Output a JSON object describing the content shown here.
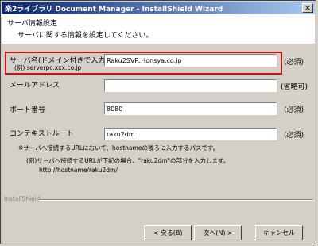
{
  "window": {
    "title": "楽2ライブラリ Document Manager - InstallShield Wizard",
    "close_label": "✕"
  },
  "header": {
    "title": "サーバ情報設定",
    "subtitle": "サーバに関する情報を設定してください。"
  },
  "form": {
    "server": {
      "label": "サーバ名(ドメイン付きで入力)",
      "example": "(例) serverpc.xxx.co.jp",
      "value": "Raku2SVR.Honsya.co.jp",
      "req": "(必須)"
    },
    "mail": {
      "label": "メールアドレス",
      "value": "",
      "req": "(省略可)"
    },
    "port": {
      "label": "ポート番号",
      "value": "8080",
      "req": "(必須)"
    },
    "context": {
      "label": "コンテキストルート",
      "value": "raku2dm",
      "req": "(必須)"
    }
  },
  "notes": {
    "line1": "※サーバへ接続するURLにおいて、hostnameの後ろに入力するパスです。",
    "line2": "(例)サーバへ接続するURLが下記の場合、\"raku2dm\"の部分を入力します。",
    "line3": "http://hostname/raku2dm/"
  },
  "brand": "InstallShield",
  "buttons": {
    "back": "< 戻る(B)",
    "next": "次へ(N) >",
    "cancel": "キャンセル"
  }
}
